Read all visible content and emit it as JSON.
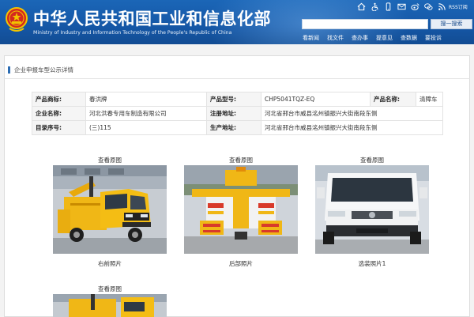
{
  "header": {
    "title": "中华人民共和国工业和信息化部",
    "subtitle": "Ministry of Industry and Information Technology of the People's Republic of China",
    "rss_label": "RSS订阅",
    "search": {
      "value": "",
      "button_label": "搜一搜索"
    },
    "nav": [
      "看新闻",
      "找文件",
      "查办事",
      "提意见",
      "查数据",
      "要投诉"
    ],
    "colors": {
      "header_blue": "#1557a6",
      "accent": "#2b6cb3"
    }
  },
  "breadcrumb": {
    "text": "企业申报车型公示详情"
  },
  "info": {
    "rows": [
      [
        {
          "label": "产品商标:",
          "value": "春洪牌"
        },
        {
          "label": "产品型号:",
          "value": "CHP5041TQZ-EQ"
        },
        {
          "label": "产品名称:",
          "value": "清障车"
        }
      ],
      [
        {
          "label": "企业名称:",
          "value": "河北洪春专用车制造有限公司"
        },
        {
          "label": "注册地址:",
          "value": "河北省邢台市威县洺州镇振兴大街南段东侧"
        }
      ],
      [
        {
          "label": "目录序号:",
          "value": "(三)115"
        },
        {
          "label": "生产地址:",
          "value": "河北省邢台市威县洺州镇振兴大街南段东侧"
        }
      ]
    ]
  },
  "photos": [
    {
      "top_label": "查看原图",
      "bottom_label": "右前照片"
    },
    {
      "top_label": "查看原图",
      "bottom_label": "后部照片"
    },
    {
      "top_label": "查看原图",
      "bottom_label": "选装照片1"
    },
    {
      "top_label": "查看原图",
      "bottom_label": ""
    }
  ]
}
